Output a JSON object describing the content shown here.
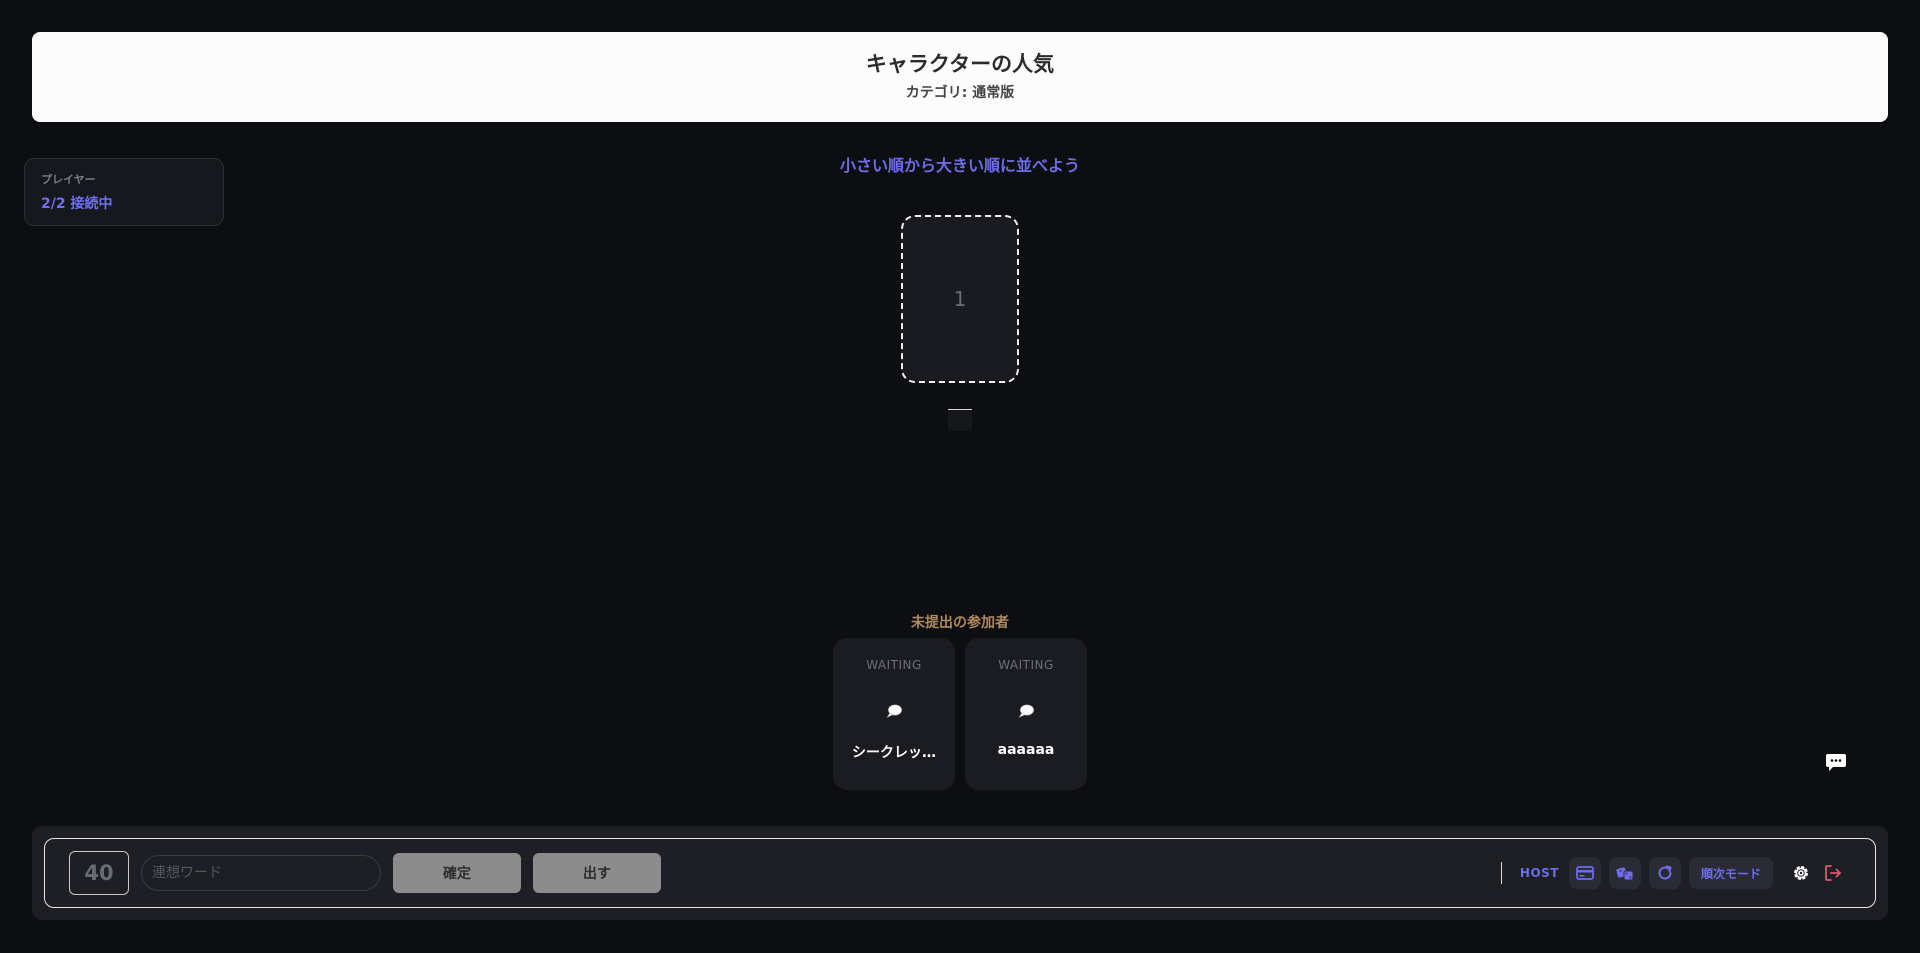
{
  "topic": {
    "title": "キャラクターの人気",
    "category": "カテゴリ: 通常版"
  },
  "players": {
    "label": "プレイヤー",
    "status": "2/2 接続中"
  },
  "board": {
    "instruction": "小さい順から大きい順に並べよう",
    "slots": [
      "1"
    ]
  },
  "pending": {
    "title": "未提出の参加者",
    "participants": [
      {
        "status": "WAITING",
        "name": "シークレッ…"
      },
      {
        "status": "WAITING",
        "name": "aaaaaa"
      }
    ]
  },
  "footer": {
    "number": "40",
    "input_placeholder": "連想ワード",
    "confirm_label": "確定",
    "submit_label": "出す",
    "host_label": "HOST",
    "mode_label": "順次モード"
  },
  "colors": {
    "accent": "#6d6de8",
    "background": "#0d0e12",
    "pending_title": "#b08a5c",
    "exit": "#e0566a"
  },
  "icons": {
    "card": "card-icon",
    "shuffle": "dice-icon",
    "reset": "refresh-icon",
    "settings": "gear-icon",
    "exit": "logout-icon",
    "chat": "chat-bubble-icon"
  }
}
